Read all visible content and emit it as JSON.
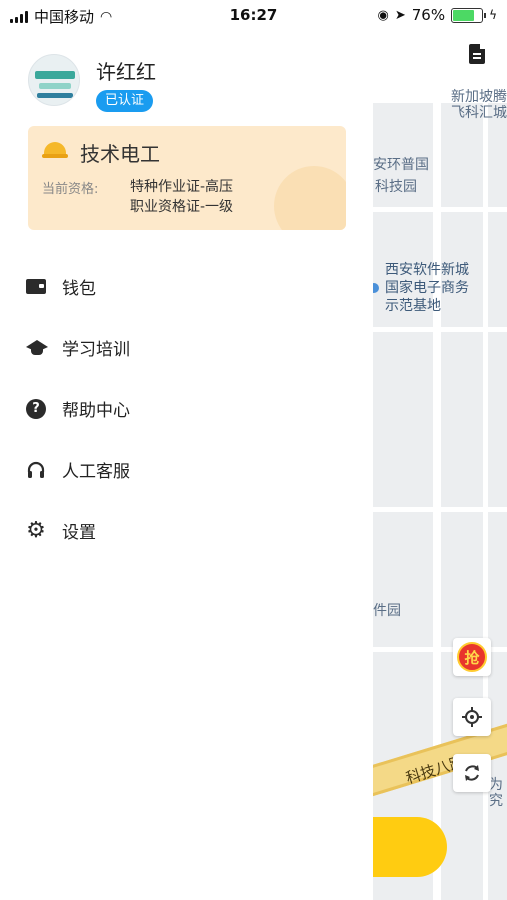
{
  "status_bar": {
    "carrier": "中国移动",
    "time": "16:27",
    "battery_percent": "76%",
    "battery_level": 0.76
  },
  "profile": {
    "name": "许红红",
    "verified_badge": "已认证"
  },
  "qualification_card": {
    "title": "技术电工",
    "label": "当前资格:",
    "items": [
      "特种作业证-高压",
      "职业资格证-一级"
    ]
  },
  "menu": [
    {
      "label": "钱包",
      "icon": "wallet-icon"
    },
    {
      "label": "学习培训",
      "icon": "graduation-cap-icon"
    },
    {
      "label": "帮助中心",
      "icon": "help-icon"
    },
    {
      "label": "人工客服",
      "icon": "headset-icon"
    },
    {
      "label": "设置",
      "icon": "gear-icon"
    }
  ],
  "map": {
    "labels": [
      "新加坡腾",
      "飞科汇城",
      "安环普国",
      "科技园",
      "西安软件新城",
      "国家电子商务",
      "示范基地",
      "件园",
      "科技八路",
      "为",
      "究"
    ],
    "grab_badge": "抢"
  },
  "colors": {
    "accent_blue": "#1a9cf0",
    "card_bg": "#fde9cb",
    "map_bg": "#eceef0",
    "action_yellow": "#ffcc11",
    "badge_red": "#e8352c"
  }
}
